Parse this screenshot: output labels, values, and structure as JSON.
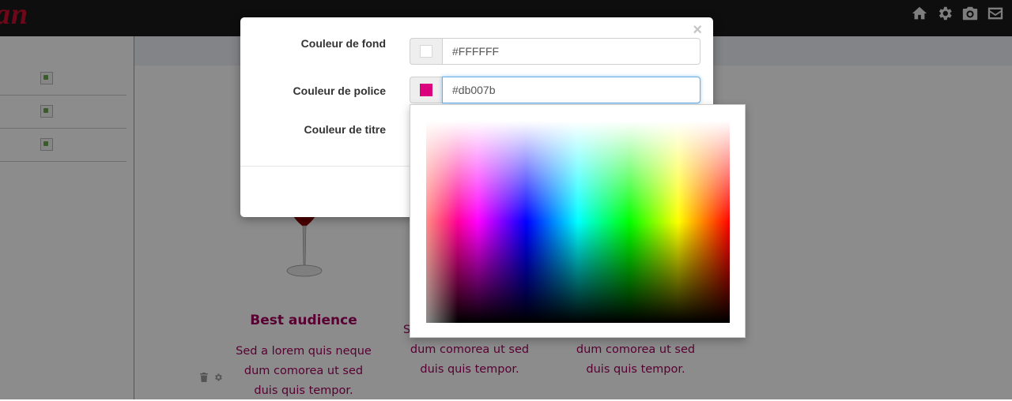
{
  "header": {
    "logo_text": "an",
    "icons": [
      "home-icon",
      "gear-icon",
      "camera-icon",
      "envelope-icon"
    ]
  },
  "features": [
    {
      "title": "Best audience",
      "lines": [
        "Sed a lorem quis neque",
        "dum comorea ut sed",
        "duis quis tempor."
      ]
    },
    {
      "partial_char": "S",
      "lines": [
        "dum comorea ut sed",
        "duis quis tempor."
      ]
    },
    {
      "lines": [
        "dum comorea ut sed",
        "duis quis tempor."
      ]
    }
  ],
  "modal": {
    "close_label": "×",
    "fields": [
      {
        "label": "Couleur de fond",
        "value": "#FFFFFF",
        "swatch": "#FFFFFF"
      },
      {
        "label": "Couleur de police",
        "value": "#db007b",
        "swatch": "#db007b"
      },
      {
        "label": "Couleur de titre"
      }
    ]
  },
  "colors": {
    "accent_text": "#a3005d",
    "header_bg": "#1b1b1b",
    "focus_border": "#66afe9"
  }
}
